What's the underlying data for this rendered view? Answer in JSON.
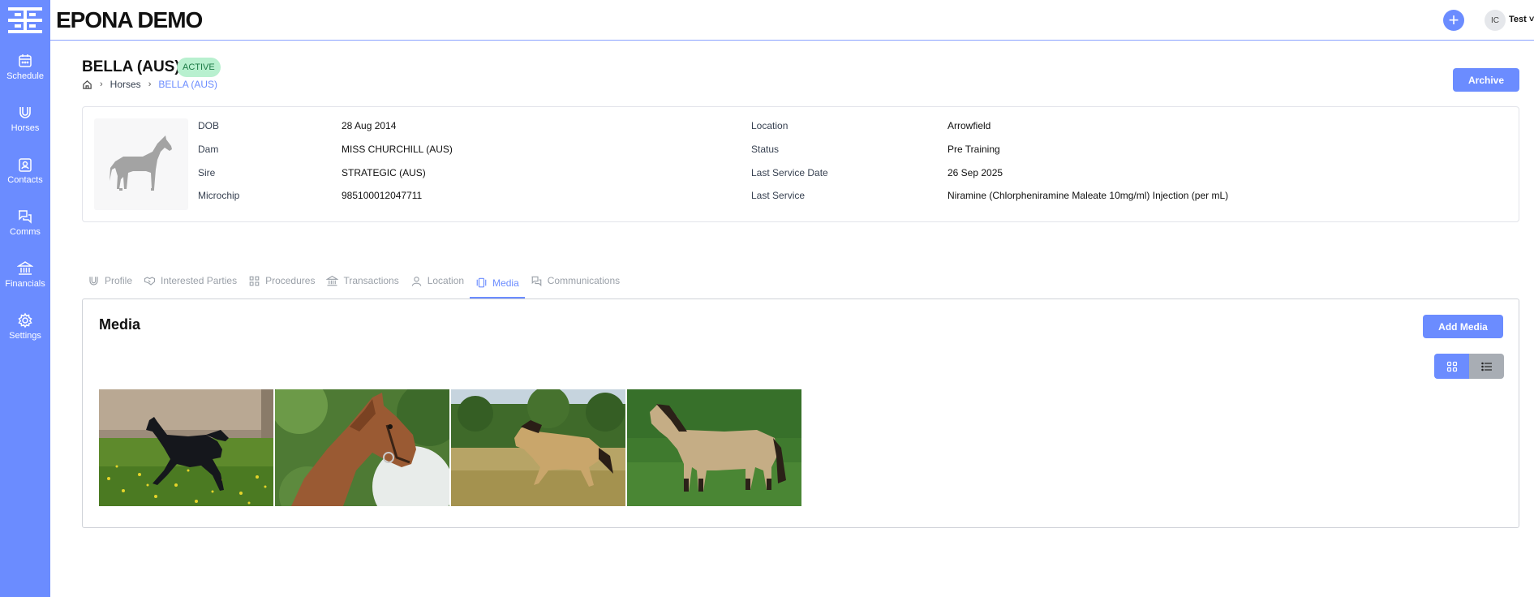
{
  "app": {
    "title": "EPONA DEMO"
  },
  "header": {
    "add_icon": "plus-icon",
    "avatar_initials": "IC",
    "user_name": "Test"
  },
  "sidebar": {
    "items": [
      {
        "label": "Schedule",
        "icon": "calendar-icon"
      },
      {
        "label": "Horses",
        "icon": "horseshoe-icon"
      },
      {
        "label": "Contacts",
        "icon": "contact-card-icon"
      },
      {
        "label": "Comms",
        "icon": "chat-icon"
      },
      {
        "label": "Financials",
        "icon": "bank-icon"
      },
      {
        "label": "Settings",
        "icon": "gear-icon"
      }
    ]
  },
  "page": {
    "title": "BELLA (AUS)",
    "status": "ACTIVE",
    "breadcrumb": {
      "home_icon": "home-icon",
      "parent": "Horses",
      "current": "BELLA (AUS)"
    },
    "archive_label": "Archive"
  },
  "details": {
    "left": [
      {
        "label": "DOB",
        "value": "28 Aug 2014"
      },
      {
        "label": "Dam",
        "value": "MISS CHURCHILL (AUS)"
      },
      {
        "label": "Sire",
        "value": "STRATEGIC (AUS)"
      },
      {
        "label": "Microchip",
        "value": "985100012047711"
      }
    ],
    "right": [
      {
        "label": "Location",
        "value": "Arrowfield"
      },
      {
        "label": "Status",
        "value": "Pre Training"
      },
      {
        "label": "Last Service Date",
        "value": "26 Sep 2025"
      },
      {
        "label": "Last Service",
        "value": "Niramine (Chlorpheniramine Maleate 10mg/ml) Injection (per mL)"
      }
    ]
  },
  "tabs": [
    {
      "label": "Profile",
      "icon": "horseshoe-icon",
      "active": false
    },
    {
      "label": "Interested Parties",
      "icon": "handshake-icon",
      "active": false
    },
    {
      "label": "Procedures",
      "icon": "grid-icon",
      "active": false
    },
    {
      "label": "Transactions",
      "icon": "bank-icon",
      "active": false
    },
    {
      "label": "Location",
      "icon": "person-pin-icon",
      "active": false
    },
    {
      "label": "Media",
      "icon": "media-icon",
      "active": true
    },
    {
      "label": "Communications",
      "icon": "chat-icon",
      "active": false
    }
  ],
  "media": {
    "title": "Media",
    "add_label": "Add Media",
    "view_modes": [
      "grid-view-icon",
      "list-view-icon"
    ],
    "active_view": "grid",
    "colors": {
      "accent": "#6b8cff",
      "list_toggle": "#a8adb4",
      "badge_bg": "#b8f0cf",
      "badge_text": "#1c7a45"
    }
  }
}
